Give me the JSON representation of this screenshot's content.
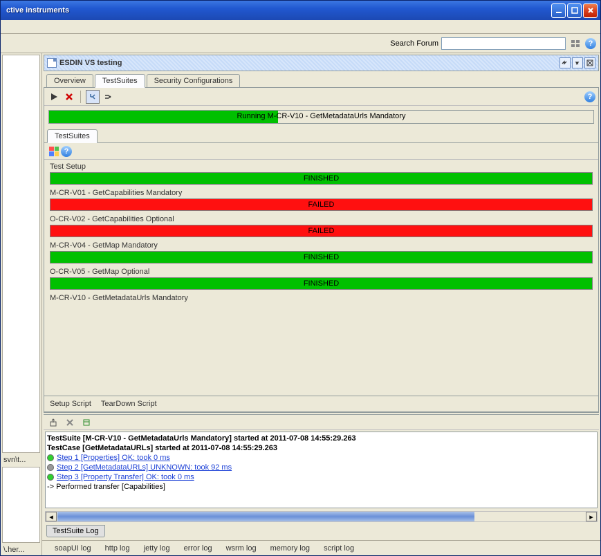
{
  "window": {
    "title": "ctive instruments"
  },
  "search": {
    "label": "Search Forum",
    "value": ""
  },
  "left_pane": {
    "label1": "svn\\t...",
    "label2": "\\.her..."
  },
  "panel": {
    "title": "ESDIN VS testing",
    "tabs": [
      "Overview",
      "TestSuites",
      "Security Configurations"
    ],
    "active_tab": 1
  },
  "progress": {
    "percent": 42,
    "text": "Running M-CR-V10 - GetMetadataUrls Mandatory"
  },
  "inner_tab": "TestSuites",
  "tests": [
    {
      "label": "Test Setup",
      "status": "FINISHED"
    },
    {
      "label": "M-CR-V01 - GetCapabilities Mandatory",
      "status": "FAILED"
    },
    {
      "label": "O-CR-V02 - GetCapabilities Optional",
      "status": "FAILED"
    },
    {
      "label": "M-CR-V04 - GetMap Mandatory",
      "status": "FINISHED"
    },
    {
      "label": "O-CR-V05 - GetMap Optional",
      "status": "FINISHED"
    },
    {
      "label": "M-CR-V10 - GetMetadataUrls Mandatory",
      "status": ""
    }
  ],
  "script_tabs": [
    "Setup Script",
    "TearDown Script"
  ],
  "log": {
    "header1": "TestSuite [M-CR-V10 - GetMetadataUrls Mandatory] started at 2011-07-08 14:55:29.263",
    "header2": "TestCase [GetMetadataURLs] started at 2011-07-08 14:55:29.263",
    "steps": [
      {
        "dot": "green",
        "text": "Step 1 [Properties] OK: took 0 ms"
      },
      {
        "dot": "grey",
        "text": "Step 2 [GetMetadataURLs] UNKNOWN: took 92 ms"
      },
      {
        "dot": "green",
        "text": "Step 3 [Property Transfer] OK: took 0 ms"
      }
    ],
    "footer": "-> Performed transfer [Capabilities]",
    "tab": "TestSuite Log"
  },
  "bottom_tabs": [
    "soapUI log",
    "http log",
    "jetty log",
    "error log",
    "wsrm log",
    "memory log",
    "script log"
  ]
}
